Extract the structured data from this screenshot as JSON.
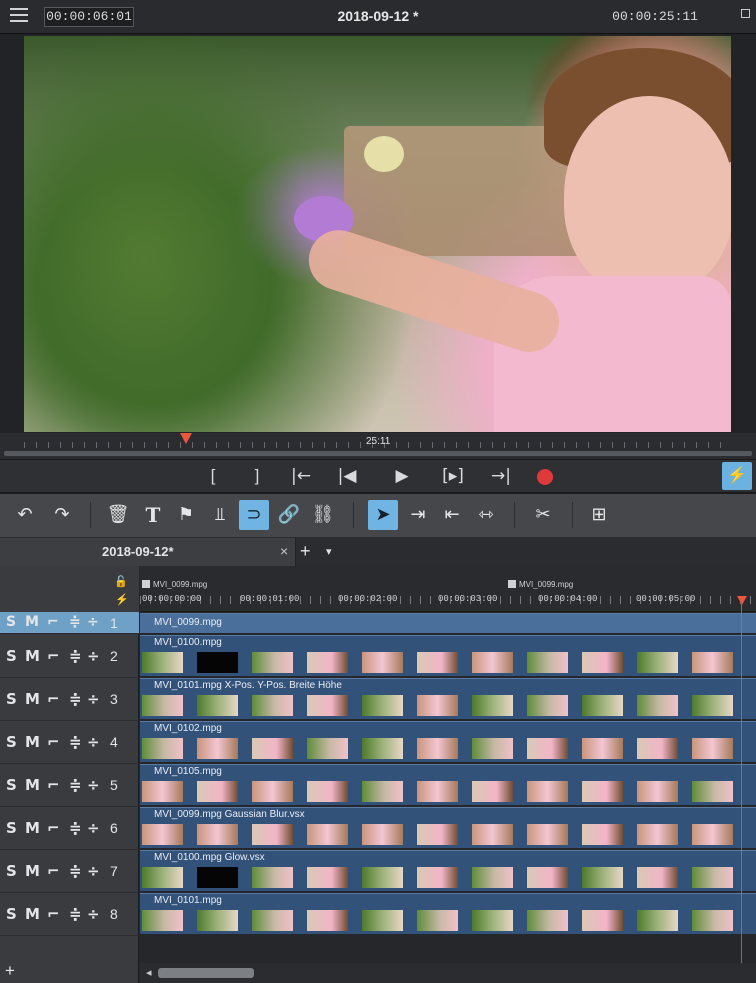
{
  "header": {
    "menu_icon": "hamburger-icon",
    "current_timecode": "00:00:06:01",
    "project_title": "2018-09-12 *",
    "total_timecode": "00:00:25:11"
  },
  "scrubber": {
    "position_label": "25:11"
  },
  "transport": {
    "mark_in": "[",
    "mark_out": "]",
    "prev_marker": "|←",
    "prev_frame": "|◀",
    "play": "▶",
    "next_frame": "[▸]",
    "next_marker": "→|",
    "record_icon": "record-icon",
    "smart_icon": "lightning-icon",
    "smart_label": "⚡"
  },
  "toolbar": {
    "undo": "↶",
    "redo": "↷",
    "delete": "🗑",
    "title": "T",
    "marker": "⚑",
    "mixer": "⫫",
    "magnet": "⊃",
    "link": "🔗",
    "unlink": "⛓",
    "pointer": "➤",
    "range": "⇥",
    "ripple": "⇤",
    "trim": "⇿",
    "cut": "✂",
    "insert": "⊞"
  },
  "tabs": [
    {
      "label": "2018-09-12*",
      "close": "×"
    }
  ],
  "tab_add": "+",
  "tab_dropdown": "▾",
  "ruler": {
    "labels": [
      "00:00:00:00",
      "00:00:01:00",
      "00:00:02:00",
      "00:00:03:00",
      "00:00:04:00",
      "00:00:05:00"
    ],
    "markers": [
      "MVI_0099.mpg",
      "MVI_0099.mpg"
    ],
    "lock_icon": "🔓",
    "magnet_icon": "⚡"
  },
  "tracks": [
    {
      "number": "1",
      "solo": "S",
      "mute": "M",
      "clip_label": "MVI_0099.mpg"
    },
    {
      "number": "2",
      "solo": "S",
      "mute": "M",
      "clip_label": "MVI_0100.mpg"
    },
    {
      "number": "3",
      "solo": "S",
      "mute": "M",
      "clip_label": "MVI_0101.mpg  X-Pos.  Y-Pos.  Breite  Höhe"
    },
    {
      "number": "4",
      "solo": "S",
      "mute": "M",
      "clip_label": "MVI_0102.mpg"
    },
    {
      "number": "5",
      "solo": "S",
      "mute": "M",
      "clip_label": "MVI_0105.mpg"
    },
    {
      "number": "6",
      "solo": "S",
      "mute": "M",
      "clip_label": "MVI_0099.mpg  Gaussian Blur.vsx"
    },
    {
      "number": "7",
      "solo": "S",
      "mute": "M",
      "clip_label": "MVI_0100.mpg  Glow.vsx"
    },
    {
      "number": "8",
      "solo": "S",
      "mute": "M",
      "clip_label": "MVI_0101.mpg"
    }
  ],
  "track_icons": {
    "lock": "⌐",
    "up_down": "≑",
    "fold": "÷"
  },
  "add_track": "+",
  "scroll_left": "◂",
  "colors": {
    "accent": "#6fb4e3",
    "record": "#e0393b",
    "playhead": "#e9573f",
    "clip": "#33527a",
    "selected_track": "#6fa0c5"
  }
}
